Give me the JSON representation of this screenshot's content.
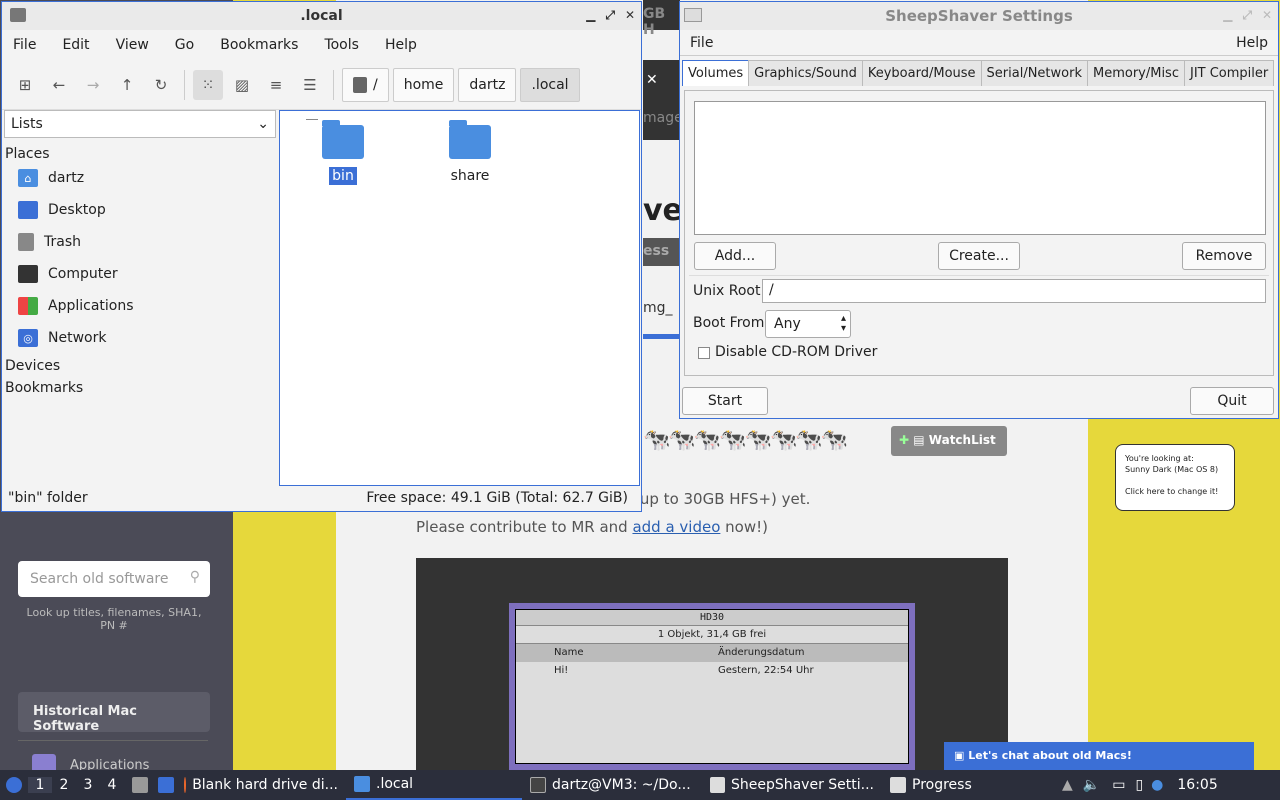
{
  "website": {
    "search_placeholder": "Search old software",
    "search_help": "Look up titles, filenames, SHA1, PN #",
    "hist_button": "Historical Mac Software",
    "frag_gbh": "GB H",
    "frag_mage": "mage",
    "frag_ve": "ve",
    "frag_ess": "ess",
    "frag_mg": "mg_",
    "text1": "rive disk images (100MB HFS up to 30GB HFS+) yet.",
    "text2_prefix": "Please contribute to MR and ",
    "text2_link": "add a video",
    "text2_suffix": " now!)",
    "watchlist": "WatchList",
    "bubble_line1": "You're looking at:",
    "bubble_line2": "Sunny Dark (Mac OS 8)",
    "bubble_line3": "Click here to change it!",
    "chat": "Let's chat about old Macs!",
    "mac_title": "HD30",
    "mac_info": "1 Objekt, 31,4 GB frei",
    "mac_col_name": "Name",
    "mac_col_date": "Änderungsdatum",
    "mac_file": "Hi!",
    "mac_file_date": "Gestern, 22:54 Uhr",
    "footer_frag": "Applications"
  },
  "file_manager": {
    "title": ".local",
    "menu": [
      "File",
      "Edit",
      "View",
      "Go",
      "Bookmarks",
      "Tools",
      "Help"
    ],
    "breadcrumbs": [
      "/",
      "home",
      "dartz",
      ".local"
    ],
    "side_selector": "Lists",
    "section_places": "Places",
    "places": [
      "dartz",
      "Desktop",
      "Trash",
      "Computer",
      "Applications",
      "Network"
    ],
    "section_devices": "Devices",
    "section_bookmarks": "Bookmarks",
    "items": [
      "bin",
      "share"
    ],
    "status_left": "\"bin\" folder",
    "status_right": "Free space: 49.1 GiB (Total: 62.7 GiB)"
  },
  "sheepshaver": {
    "title": "SheepShaver Settings",
    "menu_file": "File",
    "menu_help": "Help",
    "tabs": [
      "Volumes",
      "Graphics/Sound",
      "Keyboard/Mouse",
      "Serial/Network",
      "Memory/Misc",
      "JIT Compiler"
    ],
    "add_button": "Add...",
    "create_button": "Create...",
    "remove_button": "Remove",
    "unix_root_label": "Unix Root",
    "unix_root_value": "/",
    "boot_from_label": "Boot From",
    "boot_from_value": "Any",
    "cdrom_label": "Disable CD-ROM Driver",
    "start_button": "Start",
    "quit_button": "Quit"
  },
  "taskbar": {
    "workspaces": [
      "1",
      "2",
      "3",
      "4"
    ],
    "tasks": [
      "Blank hard drive di...",
      ".local",
      "dartz@VM3: ~/Do...",
      "SheepShaver Setti...",
      "Progress"
    ],
    "clock": "16:05"
  },
  "colors": {
    "accent": "#3b6fd6",
    "folder": "#4a8ee0",
    "site_yellow": "#e6d83b"
  }
}
